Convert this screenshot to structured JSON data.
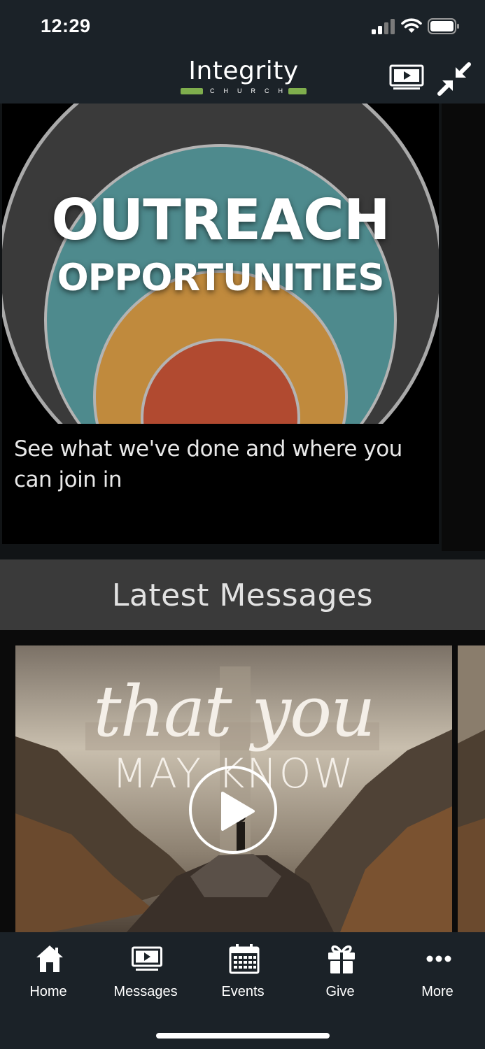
{
  "status_bar": {
    "time": "12:29"
  },
  "header": {
    "logo_word": "Integrity",
    "logo_sub": "CHURCH",
    "tv_icon": "tv-play-icon",
    "collapse_icon": "collapse-arrows-icon"
  },
  "hero": {
    "title": "OUTREACH",
    "subtitle": "OPPORTUNITIES",
    "caption": "See what we've done and where you can join in",
    "colors": {
      "outer_ring": "#3a3a3a",
      "teal": "#4e8a8d",
      "gold": "#c08a3d",
      "red": "#b14a30"
    }
  },
  "latest_messages": {
    "section_title": "Latest Messages",
    "items": [
      {
        "script_text": "that you",
        "caps_text": "MAY KNOW",
        "play_icon": "play-icon"
      }
    ]
  },
  "tab_bar": {
    "tabs": [
      {
        "label": "Home",
        "icon": "home-icon"
      },
      {
        "label": "Messages",
        "icon": "tv-play-icon"
      },
      {
        "label": "Events",
        "icon": "calendar-icon"
      },
      {
        "label": "Give",
        "icon": "gift-icon"
      },
      {
        "label": "More",
        "icon": "more-dots-icon"
      }
    ]
  }
}
